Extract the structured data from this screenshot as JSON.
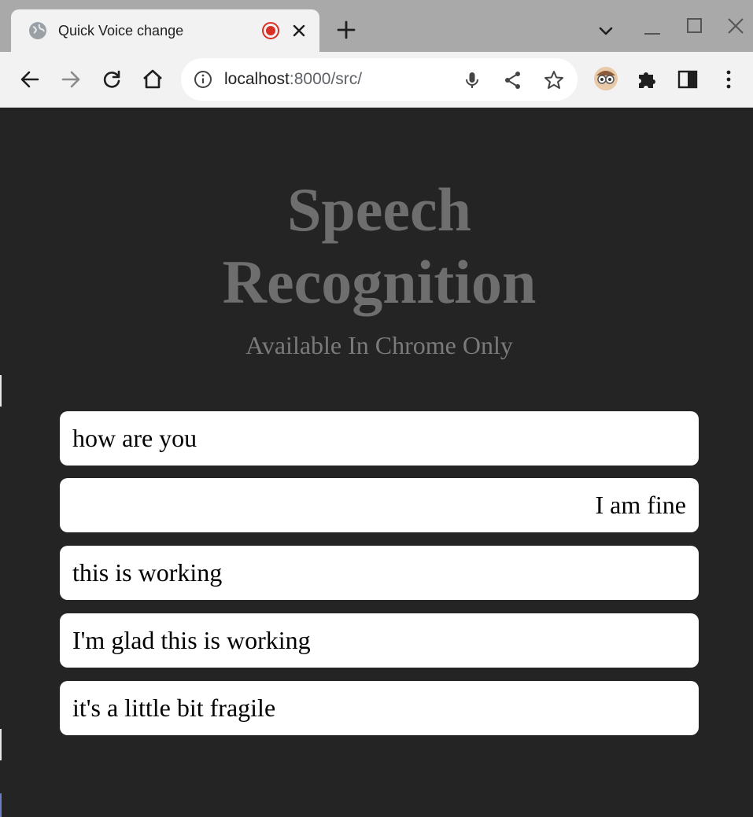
{
  "browser": {
    "tab": {
      "title": "Quick Voice change",
      "favicon_icon": "globe-icon",
      "recording_icon": "recording-dot-icon",
      "close_icon": "close-icon"
    },
    "new_tab_icon": "plus-icon",
    "tab_search_icon": "chevron-down-icon",
    "window_controls": [
      "minimize-icon",
      "maximize-icon",
      "close-icon"
    ],
    "toolbar": {
      "back_icon": "arrow-left-icon",
      "forward_icon": "arrow-right-icon",
      "reload_icon": "reload-icon",
      "home_icon": "home-icon",
      "extensions": [
        "profile-avatar-icon",
        "puzzle-icon",
        "side-panel-icon",
        "kebab-menu-icon"
      ]
    },
    "omnibox": {
      "info_icon": "info-icon",
      "url_host": "localhost",
      "url_rest": ":8000/src/",
      "actions": [
        "microphone-icon",
        "share-icon",
        "star-icon"
      ]
    }
  },
  "page": {
    "title_line1": "Speech",
    "title_line2": "Recognition",
    "subtitle": "Available In Chrome Only",
    "messages": [
      {
        "text": "how are you",
        "align": "left"
      },
      {
        "text": "I am fine",
        "align": "right"
      },
      {
        "text": "this is working",
        "align": "left"
      },
      {
        "text": "I'm glad this is working",
        "align": "left"
      },
      {
        "text": "it's a little bit fragile",
        "align": "left"
      }
    ]
  },
  "colors": {
    "page_background": "#242424",
    "title": "#6e6e6e",
    "bubble": "#ffffff",
    "tab_strip": "#a9a9a9",
    "toolbar": "#f2f2f2",
    "record_red": "#d93025"
  }
}
